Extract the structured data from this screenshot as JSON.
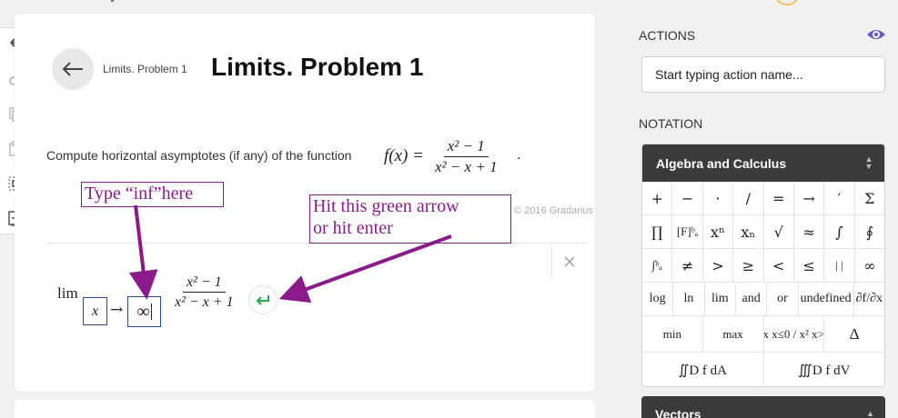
{
  "colors": {
    "annotation": "#8b1a8b",
    "math_box_border": "#2a4aa0",
    "enter_arrow": "#22aa44",
    "palette_header": "#3b3b3b",
    "eye": "#6a5acd"
  },
  "problem": {
    "breadcrumb": "Limits. Problem 1",
    "title": "Limits. Problem 1",
    "statement": "Compute horizontal asymptotes (if any) of the function",
    "fn_lhs": "f(x) =",
    "numerator": "x² − 1",
    "denominator": "x² − x + 1",
    "period": ".",
    "copyright": "© 2016 Gradarius"
  },
  "answer": {
    "lim": "lim",
    "var": "x",
    "arrow": "→",
    "target": "∞",
    "numerator": "x² − 1",
    "denominator": "x² − x + 1"
  },
  "annotations": {
    "type_inf": "Type “inf”here",
    "hit_enter": "Hit this green arrow\nor hit enter"
  },
  "actions": {
    "label": "ACTIONS",
    "placeholder": "Start typing action name..."
  },
  "notation": {
    "label": "NOTATION",
    "palette_title": "Algebra and Calculus",
    "rows": [
      [
        "+",
        "−",
        "·",
        "/",
        "=",
        "→",
        "′",
        "Σ"
      ],
      [
        "∏",
        "[F]ᵇₐ",
        "xⁿ",
        "xₙ",
        "√",
        "≈",
        "∫",
        "∮"
      ],
      [
        "∫ᵇₐ",
        "≠",
        ">",
        "≥",
        "<",
        "≤",
        "| |",
        "∞"
      ],
      [
        "log",
        "ln",
        "lim",
        "and",
        "or",
        "undefined",
        "∂f/∂x"
      ],
      [
        "min",
        "max",
        "{x x≤0 / x² x>0",
        "Δ"
      ],
      [
        "∬D f dA",
        "∭D f dV"
      ]
    ],
    "next_palette_title": "Vectors"
  },
  "icons": [
    "undo-icon",
    "redo-icon",
    "copy-icon",
    "paste-icon",
    "select-icon",
    "insert-icon",
    "back-arrow-icon",
    "close-icon",
    "enter-arrow-icon",
    "eye-icon",
    "updown-icon"
  ]
}
